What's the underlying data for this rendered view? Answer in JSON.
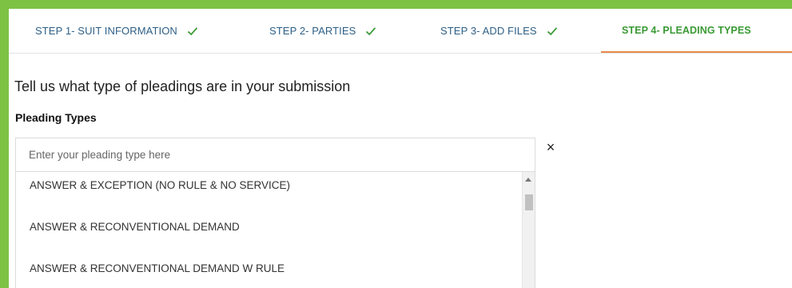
{
  "steps": [
    {
      "label": "STEP 1- SUIT INFORMATION",
      "completed": true
    },
    {
      "label": "STEP 2- PARTIES",
      "completed": true
    },
    {
      "label": "STEP 3- ADD FILES",
      "completed": true
    },
    {
      "label": "STEP 4- PLEADING TYPES",
      "completed": false,
      "active": true
    }
  ],
  "colors": {
    "frame_green": "#7dc243",
    "step_blue": "#2d5f86",
    "active_green": "#3a9a35",
    "active_underline": "#e88a4c",
    "check_green": "#3a9a35"
  },
  "main": {
    "prompt": "Tell us what type of pleadings are in your submission",
    "section_label": "Pleading Types",
    "search": {
      "placeholder": "Enter your pleading type here",
      "value": ""
    },
    "clear_icon": "×",
    "options": [
      "ANSWER & EXCEPTION (NO RULE & NO SERVICE)",
      "ANSWER & RECONVENTIONAL DEMAND",
      "ANSWER & RECONVENTIONAL DEMAND W RULE"
    ]
  }
}
